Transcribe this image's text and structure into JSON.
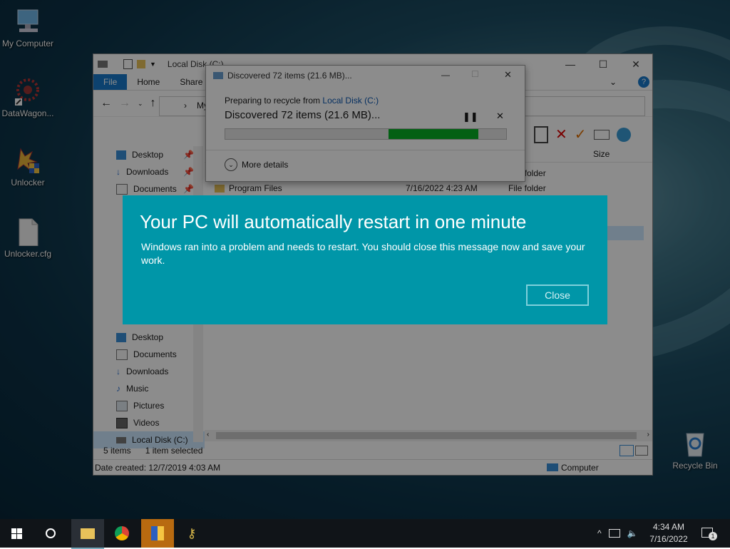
{
  "desktop": {
    "icons": [
      {
        "label": "My Computer"
      },
      {
        "label": "DataWagon..."
      },
      {
        "label": "Unlocker"
      },
      {
        "label": "Unlocker.cfg"
      },
      {
        "label": "Recycle Bin"
      }
    ]
  },
  "explorer": {
    "title": "Local Disk (C:)",
    "tabs": [
      "File",
      "Home",
      "Share"
    ],
    "address_fragment": "My",
    "nav_items": [
      {
        "label": "Desktop",
        "pinned": true
      },
      {
        "label": "Downloads",
        "pinned": true
      },
      {
        "label": "Documents",
        "pinned": true
      },
      {
        "label": "Desktop"
      },
      {
        "label": "Documents"
      },
      {
        "label": "Downloads"
      },
      {
        "label": "Music"
      },
      {
        "label": "Pictures"
      },
      {
        "label": "Videos"
      },
      {
        "label": "Local Disk (C:)"
      }
    ],
    "columns": {
      "size": "Size"
    },
    "files": [
      {
        "name": "",
        "date": "",
        "type": "folder"
      },
      {
        "name": "Program Files",
        "date": "7/16/2022 4:23 AM",
        "type": "File folder"
      }
    ],
    "status": {
      "items": "5 items",
      "selected": "1 item selected"
    },
    "details": {
      "date_created": "Date created: 12/7/2019 4:03 AM",
      "location": "Computer"
    }
  },
  "progress_dialog": {
    "title": "Discovered 72 items (21.6 MB)...",
    "preparing_prefix": "Preparing to recycle from ",
    "preparing_link": "Local Disk (C:)",
    "heading": "Discovered 72 items (21.6 MB)...",
    "progress_start": 0.58,
    "progress_end": 0.9,
    "more_details": "More details"
  },
  "restart_banner": {
    "title": "Your PC will automatically restart in one minute",
    "message": "Windows ran into a problem and needs to restart. You should close this message now and save your work.",
    "close_label": "Close"
  },
  "taskbar": {
    "time": "4:34 AM",
    "date": "7/16/2022",
    "notification_count": "1"
  },
  "colors": {
    "banner": "#0096a8",
    "progress_fill": "#06b025",
    "file_tab": "#1979ca"
  }
}
